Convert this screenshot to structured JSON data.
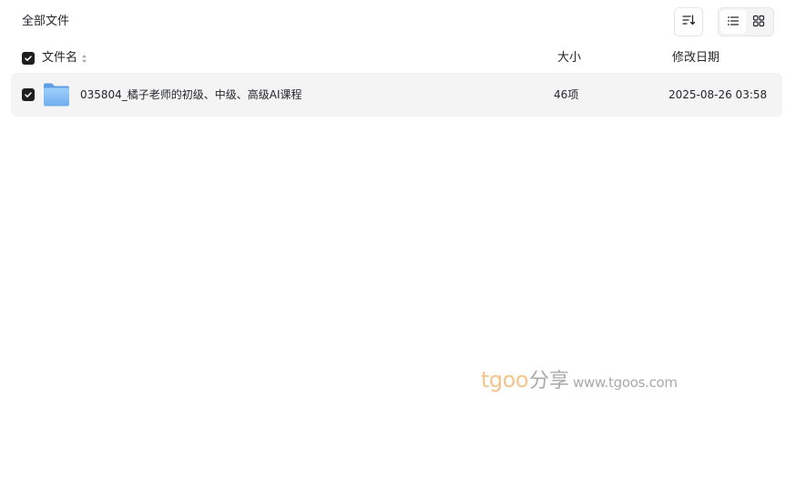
{
  "breadcrumb": {
    "label": "全部文件"
  },
  "toolbar": {
    "sort_icon": "sort-icon",
    "view_list_icon": "list-view-icon",
    "view_grid_icon": "grid-view-icon",
    "active_view": "list"
  },
  "table": {
    "columns": {
      "name": "文件名",
      "size": "大小",
      "modified": "修改日期"
    },
    "select_all_checked": true,
    "rows": [
      {
        "icon": "folder-icon",
        "name": "035804_橘子老师的初级、中级、高级AI课程",
        "size": "46项",
        "modified": "2025-08-26 03:58",
        "checked": true
      }
    ]
  },
  "watermark": {
    "brand": "tgoo",
    "cn": "分享",
    "url": "www.tgoos.com"
  },
  "colors": {
    "row_bg": "#f4f4f5",
    "checkbox": "#1f1f1f",
    "folder": "#7fb8f2",
    "watermark_brand": "#f3c48d",
    "watermark_gray": "#a9a9a9"
  }
}
